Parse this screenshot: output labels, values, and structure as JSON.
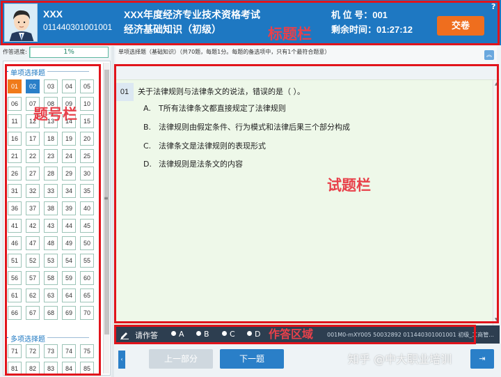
{
  "header": {
    "candidate_name": "XXX",
    "candidate_id": "011440301001001",
    "exam_title": "XXX年度经济专业技术资格考试",
    "exam_subject": "经济基础知识（初级）",
    "seat_label": "机 位 号：001",
    "time_label": "剩余时间：01:27:12",
    "submit_label": "交卷",
    "help_icon": "?"
  },
  "progress": {
    "label": "作答进度:",
    "value_text": "1%",
    "percent": 1
  },
  "left_panel": {
    "single_section_label": "单项选择题",
    "multi_section_label": "多项选择题",
    "single_numbers": [
      "01",
      "02",
      "03",
      "04",
      "05",
      "06",
      "07",
      "08",
      "09",
      "10",
      "11",
      "12",
      "13",
      "14",
      "15",
      "16",
      "17",
      "18",
      "19",
      "20",
      "21",
      "22",
      "23",
      "24",
      "25",
      "26",
      "27",
      "28",
      "29",
      "30",
      "31",
      "32",
      "33",
      "34",
      "35",
      "36",
      "37",
      "38",
      "39",
      "40",
      "41",
      "42",
      "43",
      "44",
      "45",
      "46",
      "47",
      "48",
      "49",
      "50",
      "51",
      "52",
      "53",
      "54",
      "55",
      "56",
      "57",
      "58",
      "59",
      "60",
      "61",
      "62",
      "63",
      "64",
      "65",
      "66",
      "67",
      "68",
      "69",
      "70"
    ],
    "multi_numbers": [
      "71",
      "72",
      "73",
      "74",
      "75",
      "81",
      "82",
      "83",
      "84",
      "85"
    ],
    "current": "01",
    "answered": [
      "02"
    ]
  },
  "question": {
    "info": "单项选择题（基础知识）（共70题，每题1分。每题的备选项中，只有1个最符合题意）",
    "number": "01",
    "stem": "关于法律规则与法律条文的说法，错误的是（    ）。",
    "options": [
      {
        "letter": "A.",
        "text": "T所有法律条文都直接规定了法律规则"
      },
      {
        "letter": "B.",
        "text": "法律规则由假定条件、行为模式和法律后果三个部分构成"
      },
      {
        "letter": "C.",
        "text": "法律条文是法律规则的表现形式"
      },
      {
        "letter": "D.",
        "text": "法律规则是法条文的内容"
      }
    ]
  },
  "answer_bar": {
    "label": "请作答",
    "choices": [
      "A",
      "B",
      "C",
      "D"
    ],
    "info": "001M0-mXY005  50032892 011440301001001 初级_工商管..."
  },
  "nav": {
    "left_arrow": "‹",
    "prev_label": "上一部分",
    "next_label": "下一题",
    "right_label": "⇥"
  },
  "annotations": {
    "title_bar": "标题栏",
    "number_bar": "题号栏",
    "question_bar": "试题栏",
    "answer_area": "作答区域"
  },
  "watermark": "知乎 @中大职业培训",
  "colors": {
    "header_bg": "#1e78c2",
    "submit_bg": "#ef6e1e",
    "annotation_red": "#e1141c",
    "question_bg": "#eef8e9",
    "answer_bar_bg": "#2d3e50"
  }
}
